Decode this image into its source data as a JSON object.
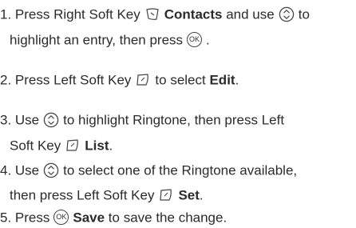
{
  "steps": [
    {
      "num": "1.",
      "lines": [
        [
          {
            "t": "Press Right Soft Key"
          },
          {
            "icon": "right-soft-key-icon"
          },
          {
            "b": "Contacts"
          },
          {
            "t": " and use"
          },
          {
            "icon": "nav-key-icon"
          },
          {
            "t": "to"
          }
        ],
        [
          {
            "t": "highlight an entry, then press"
          },
          {
            "icon": "ok-key-icon",
            "label": "OK"
          },
          {
            "t": "."
          }
        ]
      ]
    },
    {
      "num": "2.",
      "lines": [
        [
          {
            "t": "Press Left Soft Key"
          },
          {
            "icon": "left-soft-key-icon"
          },
          {
            "t": "to select "
          },
          {
            "b": "Edit"
          },
          {
            "t": "."
          }
        ]
      ]
    },
    {
      "num": "3.",
      "lines": [
        [
          {
            "t": "Use"
          },
          {
            "icon": "nav-key-icon"
          },
          {
            "t": "to highlight Ringtone, then press Left"
          }
        ],
        [
          {
            "t": "Soft Key"
          },
          {
            "icon": "left-soft-key-icon"
          },
          {
            "b": "List"
          },
          {
            "t": "."
          }
        ]
      ]
    },
    {
      "num": "4.",
      "lines": [
        [
          {
            "t": "Use"
          },
          {
            "icon": "nav-key-icon"
          },
          {
            "t": "to select one of the Ringtone available,"
          }
        ],
        [
          {
            "t": "then press Left Soft Key"
          },
          {
            "icon": "left-soft-key-icon"
          },
          {
            "b": "Set"
          },
          {
            "t": "."
          }
        ]
      ]
    },
    {
      "num": "5.",
      "lines": [
        [
          {
            "t": "Press"
          },
          {
            "icon": "ok-key-icon",
            "label": "OK"
          },
          {
            "b": "Save"
          },
          {
            "t": " to save the change."
          }
        ]
      ]
    }
  ]
}
